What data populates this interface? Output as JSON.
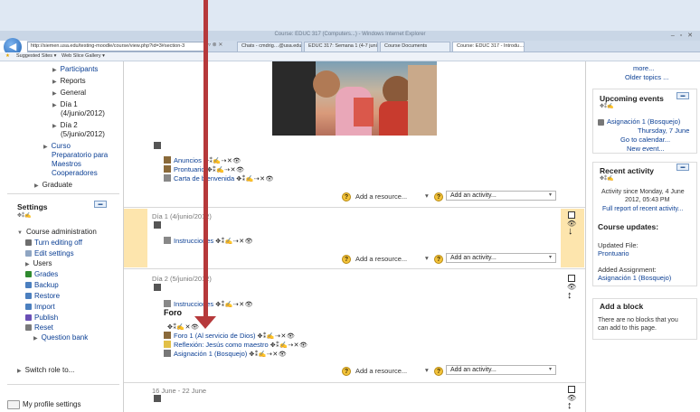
{
  "browser": {
    "window_title": "Course: EDUC 317 (Computers...) - Windows Internet Explorer",
    "window_controls": "– ▫ ✕",
    "address": "http://siemen.usa.edu/testing-moodle/course/view.php?id=3#section-3",
    "address_controls": "▿ ⊗ ✕",
    "tabs": [
      "Chats - cmdrig…@usa.edu - …",
      "EDUC 317: Semana 1 (4-7 juni…",
      "Course Documents",
      "Course: EDUC 317 - Introdu… ✕"
    ],
    "favorites": {
      "star": "★",
      "suggested": "Suggested Sites ▾",
      "gallery": "Web Slice Gallery ▾"
    }
  },
  "left": {
    "tree": [
      "Participants",
      "Reports",
      "General",
      "Día 1",
      "(4/junio/2012)",
      "Día 2",
      "(5/junio/2012)"
    ],
    "course_links": [
      "Curso",
      "Preparatorio para",
      "Maestros",
      "Cooperadores"
    ],
    "graduate": "Graduate",
    "settings_title": "Settings",
    "course_admin": "Course administration",
    "admin_items": [
      "Turn editing off",
      "Edit settings",
      "Users",
      "Grades",
      "Backup",
      "Restore",
      "Import",
      "Publish",
      "Reset",
      "Question bank"
    ],
    "switch_role": "Switch role to...",
    "profile_settings": "My profile settings"
  },
  "center": {
    "section0": {
      "items": [
        "Anuncios",
        "Prontuario",
        "Carta de bienvenida"
      ]
    },
    "section1": {
      "title": "Día 1 (4/junio/2012)",
      "items": [
        "Instrucciones"
      ]
    },
    "section2": {
      "title": "Día 2 (5/junio/2012)",
      "label_link": "Instrucciones",
      "foro": "Foro",
      "items": [
        "Foro 1 (Al servicio de Dios)",
        "Reflexión: Jesús como maestro",
        "Asignación 1 (Bosquejo)"
      ]
    },
    "section3": {
      "title": "16 June - 22 June"
    },
    "add_resource": "Add a resource...",
    "add_activity": "Add an activity...",
    "edit_tools": "✥⁑✍⇢✕👁",
    "edit_tools_short": "✥⁑✍✕👁"
  },
  "right": {
    "more": "more...",
    "older_topics": "Older topics ...",
    "upcoming_title": "Upcoming events",
    "upcoming_event": "Asignación 1 (Bosquejo)",
    "upcoming_date": "Thursday, 7 June",
    "go_calendar": "Go to calendar...",
    "new_event": "New event...",
    "recent_title": "Recent activity",
    "activity_since": "Activity since Monday, 4 June",
    "activity_time": "2012, 05:43 PM",
    "full_report": "Full report of recent activity...",
    "course_updates": "Course updates:",
    "updated_file": "Updated File:",
    "updated_file_name": "Prontuario",
    "added_assignment": "Added Assignment:",
    "added_assignment_name": "Asignación 1 (Bosquejo)",
    "add_block_title": "Add a block",
    "add_block_text_1": "There are no blocks that you",
    "add_block_text_2": "can add to this page."
  },
  "colors": {
    "link": "#0b3f94",
    "current_section": "#fde5ad",
    "annotation_arrow": "#b6393b"
  }
}
